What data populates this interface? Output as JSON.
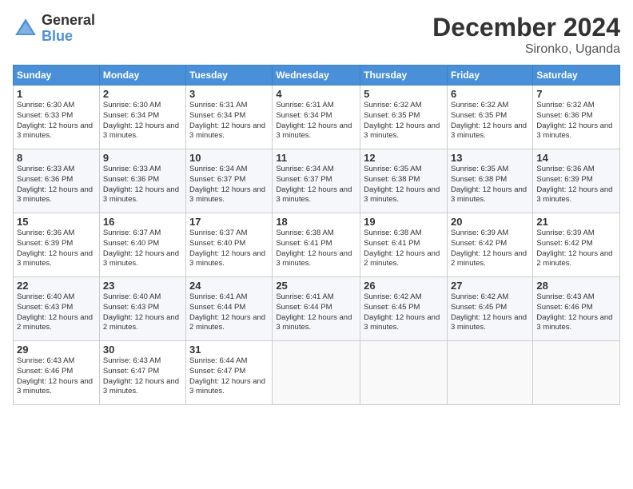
{
  "logo": {
    "general": "General",
    "blue": "Blue"
  },
  "title": "December 2024",
  "location": "Sironko, Uganda",
  "days_of_week": [
    "Sunday",
    "Monday",
    "Tuesday",
    "Wednesday",
    "Thursday",
    "Friday",
    "Saturday"
  ],
  "weeks": [
    [
      {
        "day": "1",
        "sunrise": "6:30 AM",
        "sunset": "6:33 PM",
        "daylight": "12 hours and 3 minutes."
      },
      {
        "day": "2",
        "sunrise": "6:30 AM",
        "sunset": "6:34 PM",
        "daylight": "12 hours and 3 minutes."
      },
      {
        "day": "3",
        "sunrise": "6:31 AM",
        "sunset": "6:34 PM",
        "daylight": "12 hours and 3 minutes."
      },
      {
        "day": "4",
        "sunrise": "6:31 AM",
        "sunset": "6:34 PM",
        "daylight": "12 hours and 3 minutes."
      },
      {
        "day": "5",
        "sunrise": "6:32 AM",
        "sunset": "6:35 PM",
        "daylight": "12 hours and 3 minutes."
      },
      {
        "day": "6",
        "sunrise": "6:32 AM",
        "sunset": "6:35 PM",
        "daylight": "12 hours and 3 minutes."
      },
      {
        "day": "7",
        "sunrise": "6:32 AM",
        "sunset": "6:36 PM",
        "daylight": "12 hours and 3 minutes."
      }
    ],
    [
      {
        "day": "8",
        "sunrise": "6:33 AM",
        "sunset": "6:36 PM",
        "daylight": "12 hours and 3 minutes."
      },
      {
        "day": "9",
        "sunrise": "6:33 AM",
        "sunset": "6:36 PM",
        "daylight": "12 hours and 3 minutes."
      },
      {
        "day": "10",
        "sunrise": "6:34 AM",
        "sunset": "6:37 PM",
        "daylight": "12 hours and 3 minutes."
      },
      {
        "day": "11",
        "sunrise": "6:34 AM",
        "sunset": "6:37 PM",
        "daylight": "12 hours and 3 minutes."
      },
      {
        "day": "12",
        "sunrise": "6:35 AM",
        "sunset": "6:38 PM",
        "daylight": "12 hours and 3 minutes."
      },
      {
        "day": "13",
        "sunrise": "6:35 AM",
        "sunset": "6:38 PM",
        "daylight": "12 hours and 3 minutes."
      },
      {
        "day": "14",
        "sunrise": "6:36 AM",
        "sunset": "6:39 PM",
        "daylight": "12 hours and 3 minutes."
      }
    ],
    [
      {
        "day": "15",
        "sunrise": "6:36 AM",
        "sunset": "6:39 PM",
        "daylight": "12 hours and 3 minutes."
      },
      {
        "day": "16",
        "sunrise": "6:37 AM",
        "sunset": "6:40 PM",
        "daylight": "12 hours and 3 minutes."
      },
      {
        "day": "17",
        "sunrise": "6:37 AM",
        "sunset": "6:40 PM",
        "daylight": "12 hours and 3 minutes."
      },
      {
        "day": "18",
        "sunrise": "6:38 AM",
        "sunset": "6:41 PM",
        "daylight": "12 hours and 3 minutes."
      },
      {
        "day": "19",
        "sunrise": "6:38 AM",
        "sunset": "6:41 PM",
        "daylight": "12 hours and 2 minutes."
      },
      {
        "day": "20",
        "sunrise": "6:39 AM",
        "sunset": "6:42 PM",
        "daylight": "12 hours and 2 minutes."
      },
      {
        "day": "21",
        "sunrise": "6:39 AM",
        "sunset": "6:42 PM",
        "daylight": "12 hours and 2 minutes."
      }
    ],
    [
      {
        "day": "22",
        "sunrise": "6:40 AM",
        "sunset": "6:43 PM",
        "daylight": "12 hours and 2 minutes."
      },
      {
        "day": "23",
        "sunrise": "6:40 AM",
        "sunset": "6:43 PM",
        "daylight": "12 hours and 2 minutes."
      },
      {
        "day": "24",
        "sunrise": "6:41 AM",
        "sunset": "6:44 PM",
        "daylight": "12 hours and 2 minutes."
      },
      {
        "day": "25",
        "sunrise": "6:41 AM",
        "sunset": "6:44 PM",
        "daylight": "12 hours and 3 minutes."
      },
      {
        "day": "26",
        "sunrise": "6:42 AM",
        "sunset": "6:45 PM",
        "daylight": "12 hours and 3 minutes."
      },
      {
        "day": "27",
        "sunrise": "6:42 AM",
        "sunset": "6:45 PM",
        "daylight": "12 hours and 3 minutes."
      },
      {
        "day": "28",
        "sunrise": "6:43 AM",
        "sunset": "6:46 PM",
        "daylight": "12 hours and 3 minutes."
      }
    ],
    [
      {
        "day": "29",
        "sunrise": "6:43 AM",
        "sunset": "6:46 PM",
        "daylight": "12 hours and 3 minutes."
      },
      {
        "day": "30",
        "sunrise": "6:43 AM",
        "sunset": "6:47 PM",
        "daylight": "12 hours and 3 minutes."
      },
      {
        "day": "31",
        "sunrise": "6:44 AM",
        "sunset": "6:47 PM",
        "daylight": "12 hours and 3 minutes."
      },
      null,
      null,
      null,
      null
    ]
  ]
}
